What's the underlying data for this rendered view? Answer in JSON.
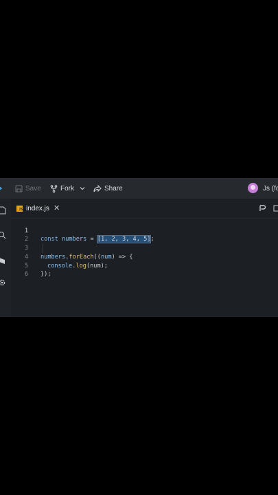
{
  "toolbar": {
    "save_label": "Save",
    "fork_label": "Fork",
    "share_label": "Share",
    "project_label": "Js (fo"
  },
  "tab": {
    "label": "index.js",
    "badge": "JS",
    "close_glyph": "✕"
  },
  "editor": {
    "lines": [
      {
        "number": "1"
      },
      {
        "number": "2"
      },
      {
        "number": "3"
      },
      {
        "number": "4"
      },
      {
        "number": "5"
      },
      {
        "number": "6"
      }
    ],
    "tokens": {
      "l1_kw": "const",
      "l1_var": "numbers",
      "l1_eq": " = ",
      "l1_arr": "[1, 2, 3, 4, 5]",
      "l1_end": ";",
      "l3_var": "numbers",
      "l3_dot": ".",
      "l3_fn": "forEach",
      "l3_open": "((",
      "l3_param": "num",
      "l3_arrow": ") => {",
      "l4_obj": "console",
      "l4_dot": ".",
      "l4_fn": "log",
      "l4_args": "(num);",
      "l5": "});"
    }
  },
  "colors": {
    "app_bg": "#1c1f23",
    "toolbar_bg": "#26292e",
    "selection": "#264f78",
    "js_badge": "#e8a31b"
  }
}
